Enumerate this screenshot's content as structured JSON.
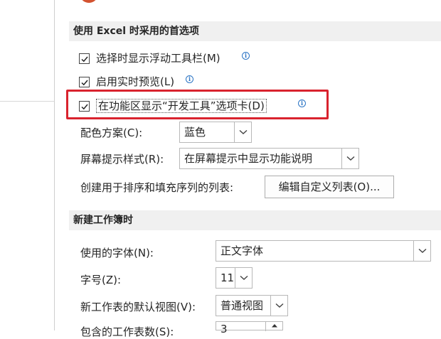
{
  "section1": {
    "title": "使用 Excel 时采用的首选项",
    "mini_toolbar": {
      "label": "选择时显示浮动工具栏(M)",
      "checked": true
    },
    "live_preview": {
      "label": "启用实时预览(L)",
      "checked": true
    },
    "developer_tab": {
      "label": "在功能区显示“开发工具”选项卡(D)",
      "checked": true
    },
    "color_scheme": {
      "label": "配色方案(C):",
      "value": "蓝色"
    },
    "screentip_style": {
      "label": "屏幕提示样式(R):",
      "value": "在屏幕提示中显示功能说明"
    },
    "custom_lists": {
      "label": "创建用于排序和填充序列的列表:",
      "button": "编辑自定义列表(O)..."
    }
  },
  "section2": {
    "title": "新建工作簿时",
    "font": {
      "label": "使用的字体(N):",
      "value": "正文字体"
    },
    "font_size": {
      "label": "字号(Z):",
      "value": "11"
    },
    "default_view": {
      "label": "新工作表的默认视图(V):",
      "value": "普通视图"
    },
    "sheet_count": {
      "label": "包含的工作表数(S):",
      "value": "3"
    }
  },
  "colors": {
    "highlight": "#d9232e",
    "info": "#2b74c4",
    "section_band": "#f0f0f0"
  }
}
